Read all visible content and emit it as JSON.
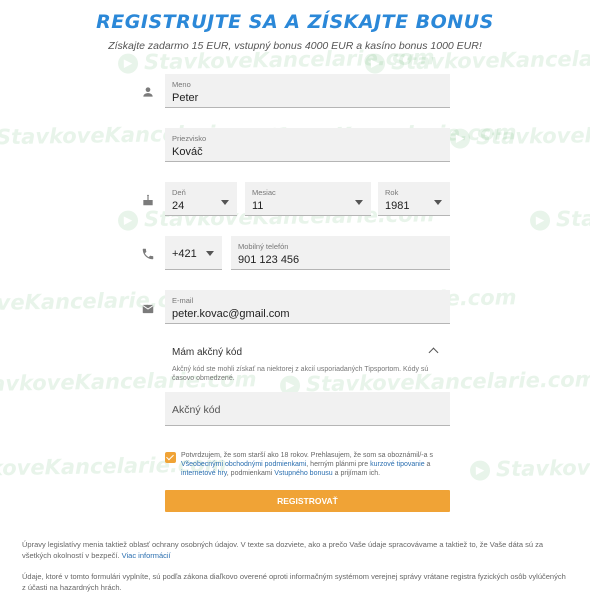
{
  "watermark": "StavkoveKancelarie.com",
  "header": {
    "title": "REGISTRUJTE SA A ZÍSKAJTE BONUS",
    "subtitle": "Získajte zadarmo 15 EUR, vstupný bonus 4000 EUR a kasíno bonus 1000 EUR!"
  },
  "form": {
    "first_name": {
      "label": "Meno",
      "value": "Peter"
    },
    "last_name": {
      "label": "Priezvisko",
      "value": "Kováč"
    },
    "day": {
      "label": "Deň",
      "value": "24"
    },
    "month": {
      "label": "Mesiac",
      "value": "11"
    },
    "year": {
      "label": "Rok",
      "value": "1981"
    },
    "phone_prefix": {
      "value": "+421"
    },
    "phone": {
      "label": "Mobilný telefón",
      "value": "901 123 456"
    },
    "email": {
      "label": "E-mail",
      "value": "peter.kovac@gmail.com"
    },
    "promo": {
      "header": "Mám akčný kód",
      "description": "Akčný kód ste mohli získať na niektorej z akcií usporiadaných Tipsportom. Kódy sú časovo obmedzené.",
      "placeholder": "Akčný kód"
    },
    "consent": {
      "part1": "Potvrdzujem, že som starší ako 18 rokov. Prehlasujem, že som sa oboznámil/-a s ",
      "link1": "Všeobecnými obchodnými podmienkami",
      "part2": ", herným plánmi pre ",
      "link2": "kurzové tipovanie",
      "part3": " a ",
      "link3": "internetové hry",
      "part4": ", podmienkami ",
      "link4": "Vstupného bonusu",
      "part5": " a prijímam ich."
    },
    "submit_label": "REGISTROVAŤ"
  },
  "footer": {
    "p1_text": "Úpravy legislatívy menia taktiež oblasť ochrany osobných údajov. V texte sa dozviete, ako a prečo Vaše údaje spracovávame a taktiež to, že Vaše dáta sú za všetkých okolností v bezpečí. ",
    "p1_link": "Viac informácií",
    "p2_text": "Údaje, ktoré v tomto formulári vyplníte, sú podľa zákona diaľkovo overené oproti informačným systémom verejnej správy vrátane registra fyzických osôb vylúčených z účasti na hazardných hrách."
  },
  "colors": {
    "accent": "#2b88d8",
    "button": "#f0a336",
    "link": "#2b6fb0"
  },
  "icons": [
    "person-icon",
    "cake-icon",
    "phone-icon",
    "mail-icon",
    "chevron-down-icon",
    "chevron-up-icon",
    "checkbox-checked-icon"
  ]
}
